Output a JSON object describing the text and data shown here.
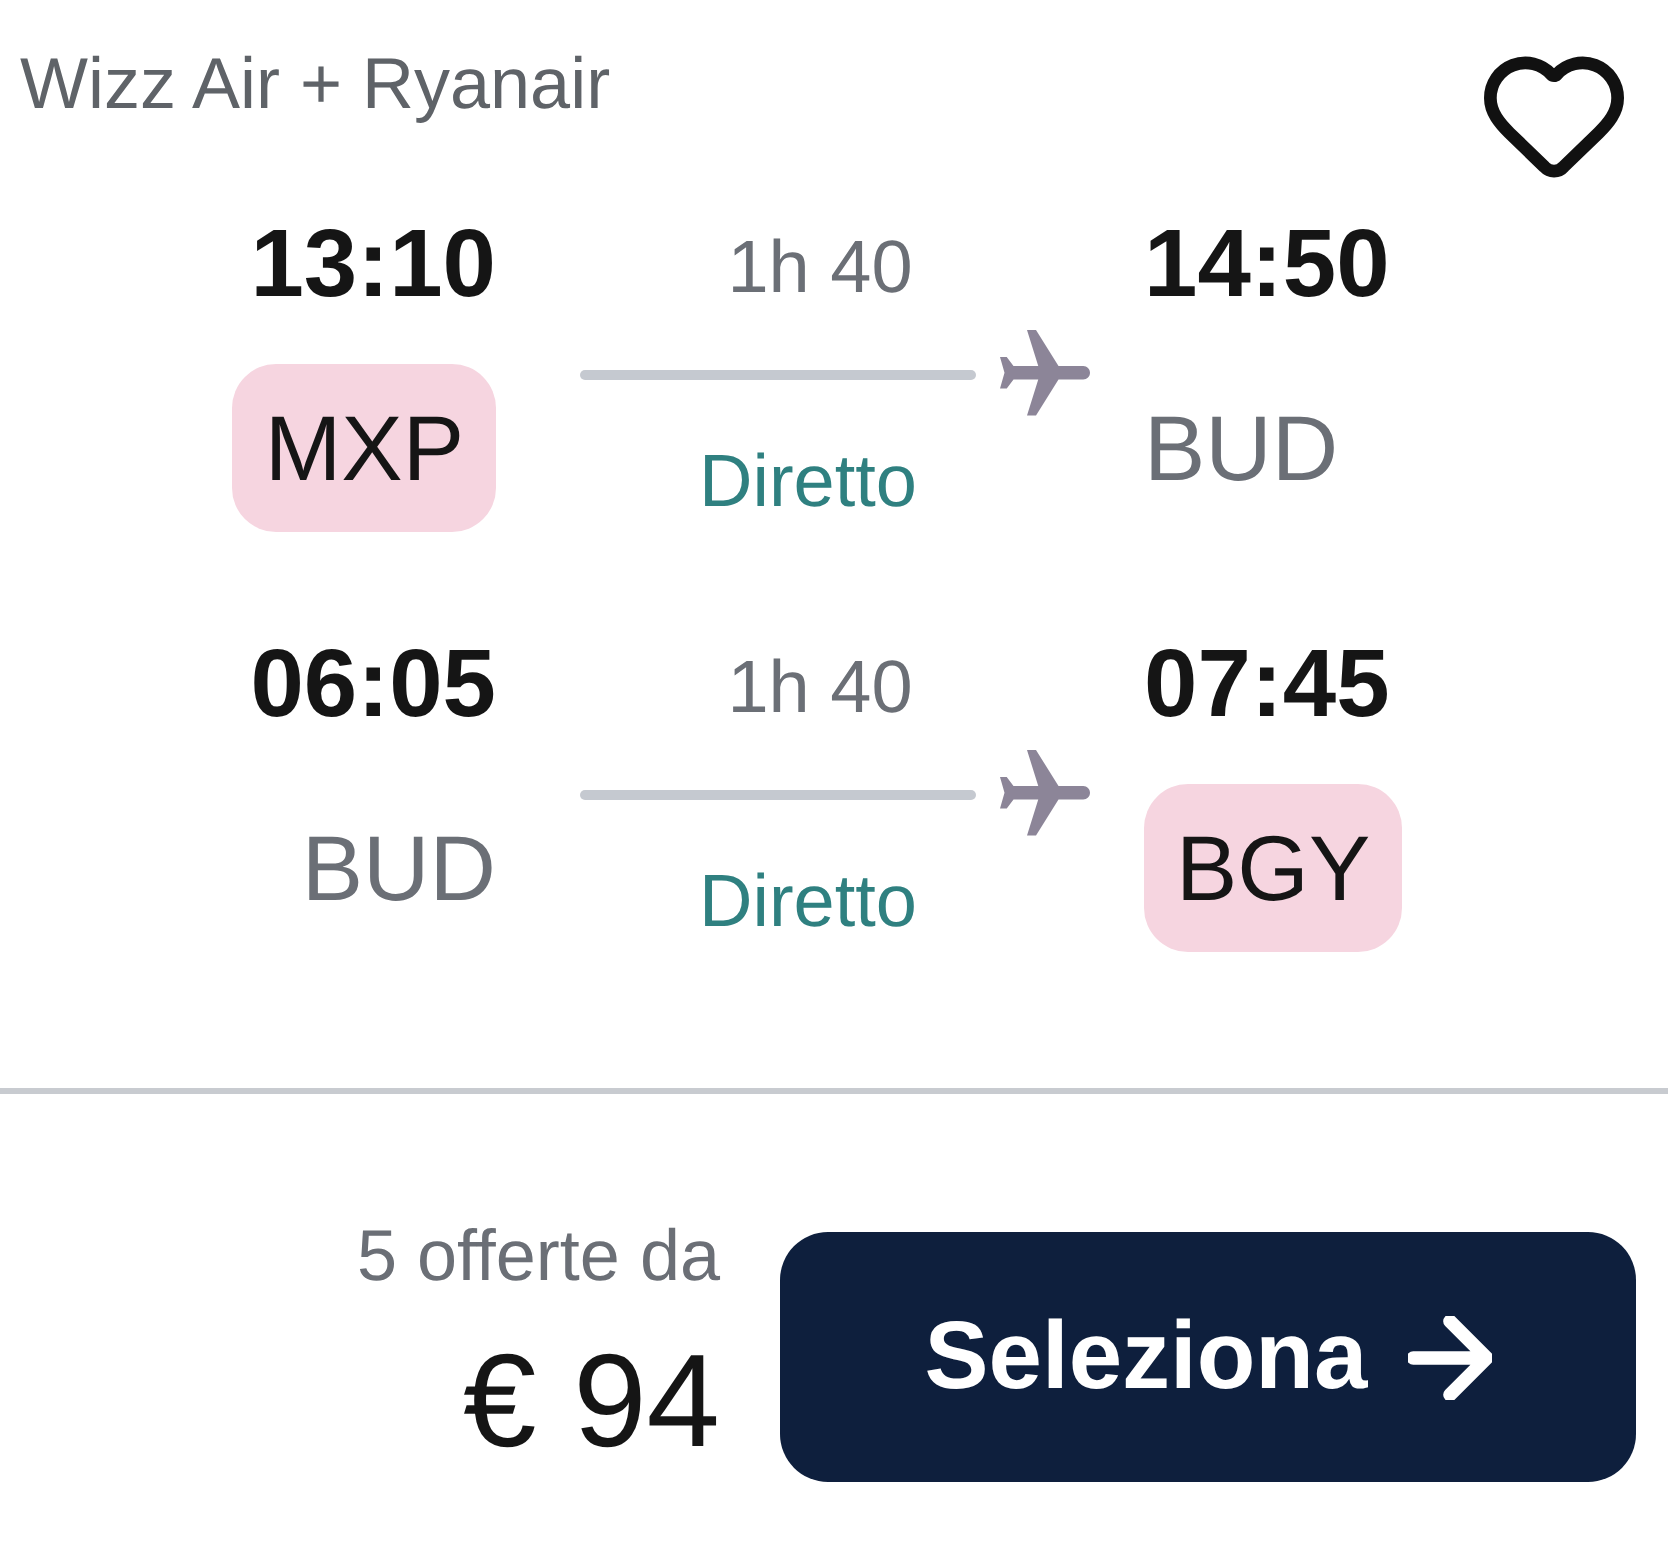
{
  "card": {
    "airlines": "Wizz Air + Ryanair",
    "saved": false
  },
  "legs": [
    {
      "departure": {
        "time": "13:10",
        "airport": "MXP",
        "highlighted": true
      },
      "duration": "1h 40",
      "stops": "Diretto",
      "arrival": {
        "time": "14:50",
        "airport": "BUD",
        "highlighted": false
      }
    },
    {
      "departure": {
        "time": "06:05",
        "airport": "BUD",
        "highlighted": false
      },
      "duration": "1h 40",
      "stops": "Diretto",
      "arrival": {
        "time": "07:45",
        "airport": "BGY",
        "highlighted": true
      }
    }
  ],
  "price": {
    "offers": "5 offerte da",
    "amount": "€ 94"
  },
  "button": {
    "label": "Seleziona"
  }
}
